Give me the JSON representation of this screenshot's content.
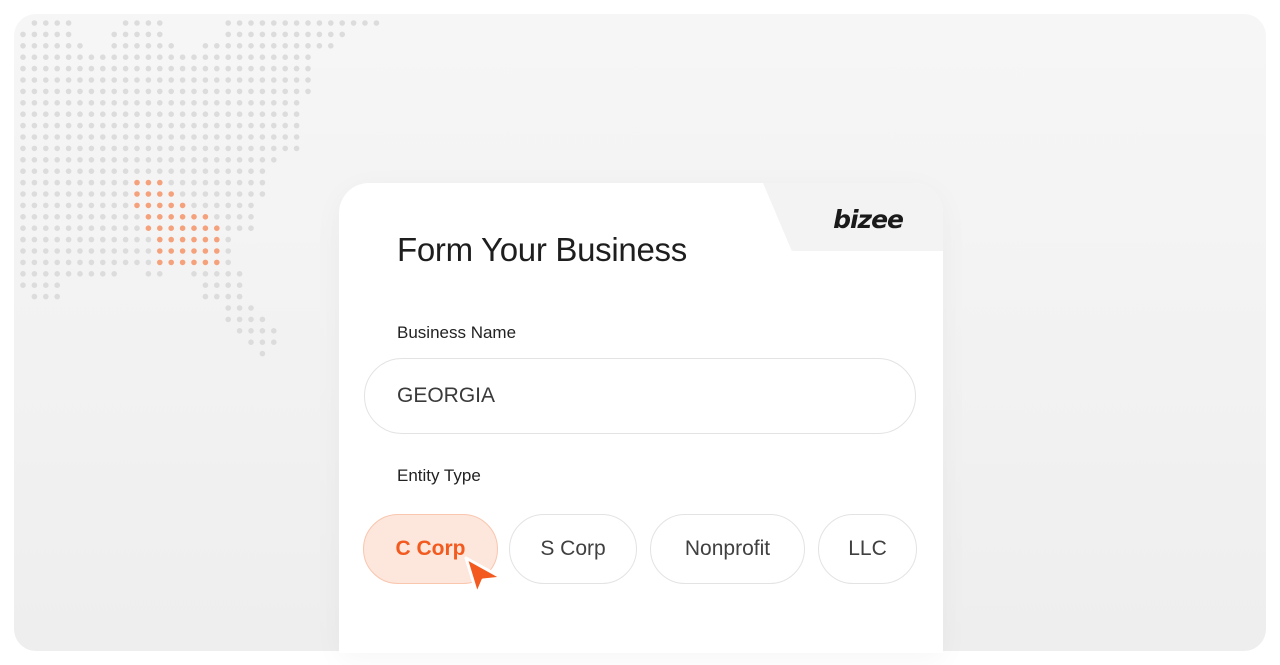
{
  "brand": {
    "logo_text": "bizee"
  },
  "form": {
    "title": "Form Your Business",
    "business_name_label": "Business Name",
    "business_name_value": "GEORGIA",
    "entity_type_label": "Entity Type",
    "entity_options": [
      "C Corp",
      "S Corp",
      "Nonprofit",
      "LLC"
    ],
    "selected_entity": "C Corp"
  },
  "colors": {
    "accent": "#f25a1f",
    "accent_light": "#fde6dc",
    "map_dot": "#dcdcdc",
    "map_highlight": "#f5a27c"
  }
}
